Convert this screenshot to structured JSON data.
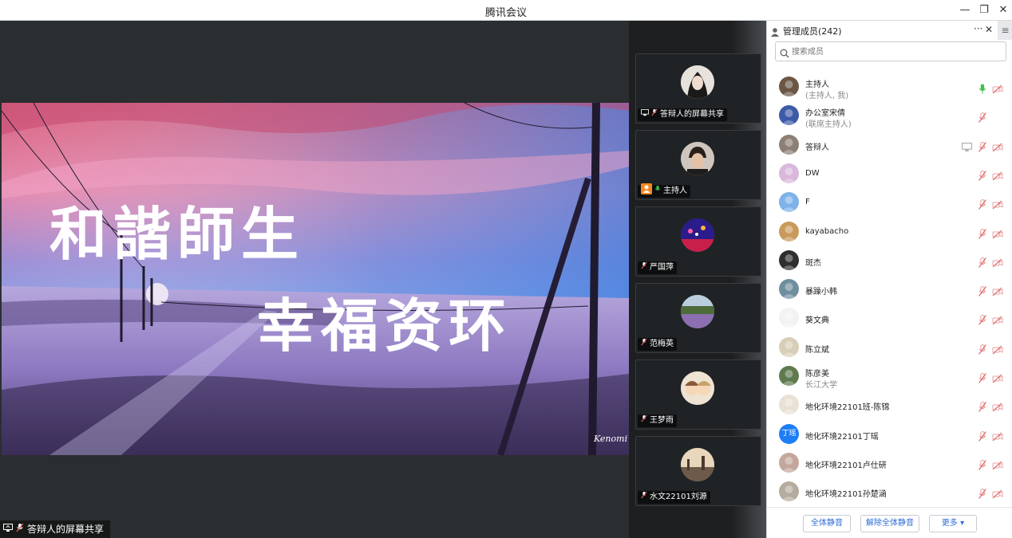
{
  "window": {
    "title": "腾讯会议",
    "min_glyph": "—",
    "restore_glyph": "❐",
    "close_glyph": "✕"
  },
  "share": {
    "caption_line1": "和諧師生",
    "caption_line2": "幸福资环",
    "signature": "Kenomi",
    "tag_label": "答辩人的屏幕共享"
  },
  "tiles": [
    {
      "label": "答辩人的屏幕共享",
      "share_badge": true,
      "mic": "muted",
      "avatar_color": "#c9c1b8"
    },
    {
      "label": "主持人",
      "host_badge": true,
      "mic": "on",
      "avatar_color": "#8a7360"
    },
    {
      "label": "严国萍",
      "mic": "muted",
      "avatar_color": "#4b3bd8"
    },
    {
      "label": "范梅英",
      "mic": "muted",
      "avatar_color": "#7a8c4c"
    },
    {
      "label": "王梦雨",
      "mic": "muted",
      "avatar_color": "#d8c3a8"
    },
    {
      "label": "水文22101刘源",
      "mic": "muted",
      "avatar_color": "#b79a7d"
    }
  ],
  "panel": {
    "title": "管理成员(242)",
    "more_glyph": "···",
    "close_glyph": "✕",
    "menu_glyph": "≡",
    "search_placeholder": "搜索成员",
    "members": [
      {
        "name": "主持人",
        "sub": "(主持人, 我)",
        "mic": "on",
        "cam": true,
        "avatar_color": "#6b5645"
      },
      {
        "name": "办公室宋倩",
        "sub": "(联席主持人)",
        "mic": "muted",
        "cam": false,
        "avatar_color": "#3e5ba8"
      },
      {
        "name": "答辩人",
        "sub": "",
        "mic": "muted",
        "cam": true,
        "share": true,
        "avatar_color": "#8d7f74"
      },
      {
        "name": "DW",
        "sub": "",
        "mic": "muted",
        "cam": true,
        "avatar_color": "#d9b8dc"
      },
      {
        "name": "F",
        "sub": "",
        "mic": "muted",
        "cam": true,
        "avatar_color": "#7fb2e8"
      },
      {
        "name": "kayabacho",
        "sub": "",
        "mic": "muted",
        "cam": true,
        "avatar_color": "#c99a5b"
      },
      {
        "name": "斑杰",
        "sub": "",
        "mic": "muted",
        "cam": true,
        "avatar_color": "#2f2f2f"
      },
      {
        "name": "暴躁小韩",
        "sub": "",
        "mic": "muted",
        "cam": true,
        "avatar_color": "#6f8e9e"
      },
      {
        "name": "葵文典",
        "sub": "",
        "mic": "muted",
        "cam": true,
        "avatar_color": "#f2f2f2"
      },
      {
        "name": "陈立斌",
        "sub": "",
        "mic": "muted",
        "cam": true,
        "avatar_color": "#d8cdb6"
      },
      {
        "name": "陈彦美",
        "sub": "长江大学",
        "mic": "muted",
        "cam": true,
        "avatar_color": "#5e7a4e"
      },
      {
        "name": "地化环境22101班-陈锦",
        "sub": "",
        "mic": "muted",
        "cam": true,
        "avatar_color": "#e9e1d6"
      },
      {
        "name": "地化环境22101丁瑶",
        "sub": "",
        "mic": "muted",
        "cam": true,
        "avatar_color": "#1e7ef5",
        "avatar_text": "丁瑶"
      },
      {
        "name": "地化环境22101卢仕研",
        "sub": "",
        "mic": "muted",
        "cam": true,
        "avatar_color": "#c4a79c"
      },
      {
        "name": "地化环境22101孙楚涵",
        "sub": "",
        "mic": "muted",
        "cam": true,
        "avatar_color": "#b5ab9e"
      }
    ],
    "footer": {
      "mute_all": "全体静音",
      "unmute_all": "解除全体静音",
      "more": "更多 ▾"
    }
  },
  "colors": {
    "accent_blue": "#2d6bd9",
    "mic_green": "#39c24a",
    "muted_red": "#e05a5a"
  }
}
